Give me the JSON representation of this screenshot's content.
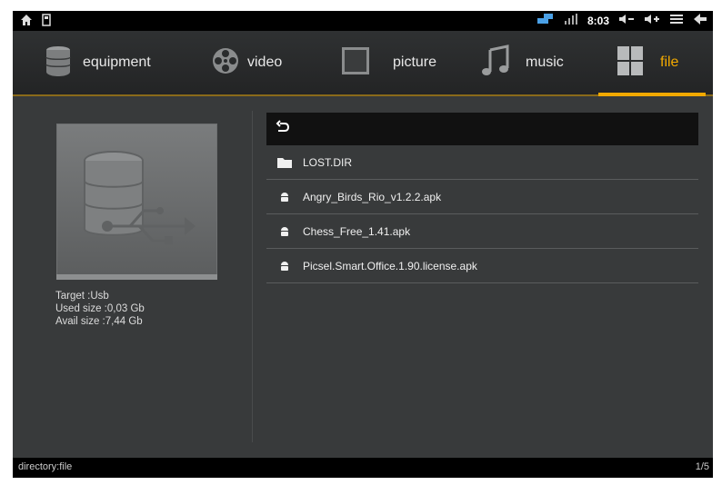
{
  "status_bar": {
    "left_icons": [
      "home-icon",
      "sd-card-icon"
    ],
    "right_icons": [
      "usb-connection-icon",
      "signal-bars-icon",
      "volume-down-icon",
      "volume-up-icon",
      "menu-icon",
      "back-arrow-icon"
    ],
    "time": "8:03"
  },
  "tabs": [
    {
      "label": "equipment",
      "icon": "database-icon"
    },
    {
      "label": "video",
      "icon": "film-reel-icon"
    },
    {
      "label": "picture",
      "icon": "picture-frame-icon"
    },
    {
      "label": "music",
      "icon": "music-note-icon"
    },
    {
      "label": "file",
      "icon": "grid-icon",
      "active": true
    }
  ],
  "device": {
    "icon": "usb-storage-icon",
    "target": "Target :Usb",
    "used_size": "Used size :0,03 Gb",
    "avail_size": "Avail size :7,44 Gb"
  },
  "file_list": {
    "back_icon": "back-icon",
    "items": [
      {
        "name": "LOST.DIR",
        "icon": "folder-icon"
      },
      {
        "name": "Angry_Birds_Rio_v1.2.2.apk",
        "icon": "android-icon"
      },
      {
        "name": "Chess_Free_1.41.apk",
        "icon": "android-icon"
      },
      {
        "name": "Picsel.Smart.Office.1.90.license.apk",
        "icon": "android-icon"
      }
    ]
  },
  "bottom_bar": {
    "directory": "directory:file",
    "page": "1/5"
  },
  "colors": {
    "accent": "#f2a900",
    "background": "#383a3b",
    "bar": "#000000"
  }
}
